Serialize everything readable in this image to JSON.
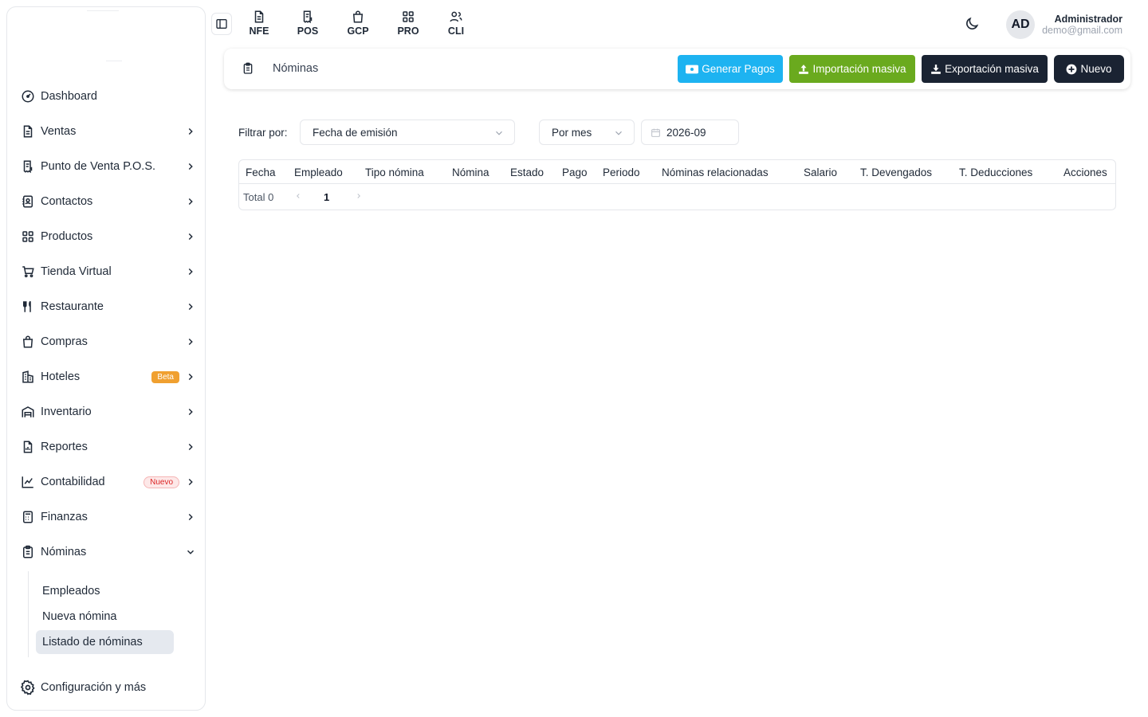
{
  "sidebar": {
    "items": [
      {
        "label": "Dashboard",
        "icon": "gauge-icon"
      },
      {
        "label": "Ventas",
        "icon": "document-icon"
      },
      {
        "label": "Punto de Venta P.O.S.",
        "icon": "pos-receipt-icon"
      },
      {
        "label": "Contactos",
        "icon": "contacts-icon"
      },
      {
        "label": "Productos",
        "icon": "grid-icon"
      },
      {
        "label": "Tienda Virtual",
        "icon": "cart-icon"
      },
      {
        "label": "Restaurante",
        "icon": "utensils-icon"
      },
      {
        "label": "Compras",
        "icon": "shopping-bag-icon"
      },
      {
        "label": "Hoteles",
        "icon": "building-icon",
        "badge": "Beta"
      },
      {
        "label": "Inventario",
        "icon": "warehouse-icon"
      },
      {
        "label": "Reportes",
        "icon": "report-icon"
      },
      {
        "label": "Contabilidad",
        "icon": "chart-icon",
        "badge": "Nuevo"
      },
      {
        "label": "Finanzas",
        "icon": "calculator-icon"
      },
      {
        "label": "Nóminas",
        "icon": "clipboard-icon"
      }
    ],
    "submenu": [
      "Empleados",
      "Nueva nómina",
      "Listado de nóminas"
    ],
    "settings_label": "Configuración y más"
  },
  "topbar": {
    "modules": [
      "NFE",
      "POS",
      "GCP",
      "PRO",
      "CLI"
    ],
    "user": {
      "initials": "AD",
      "name": "Administrador",
      "email": "demo@gmail.com"
    }
  },
  "header": {
    "title": "Nóminas",
    "buttons": {
      "pay": "Generar Pagos",
      "import": "Importación masiva",
      "export": "Exportación masiva",
      "new": "Nuevo"
    }
  },
  "filters": {
    "label": "Filtrar por:",
    "date_field": "Fecha de emisión",
    "period": "Por mes",
    "month": "2026-09"
  },
  "table": {
    "columns": [
      "Fecha",
      "Empleado",
      "Tipo nómina",
      "Nómina",
      "Estado",
      "Pago",
      "Periodo",
      "Nóminas relacionadas",
      "Salario",
      "T. Devengados",
      "T. Deducciones",
      "Acciones"
    ],
    "total_label": "Total 0",
    "current_page": "1"
  },
  "colors": {
    "pay_button": "#1db3f1",
    "import_button": "#6aaa1e",
    "dark_button": "#1a2332",
    "beta_badge": "#f0a030",
    "new_badge": "#dc2626"
  }
}
